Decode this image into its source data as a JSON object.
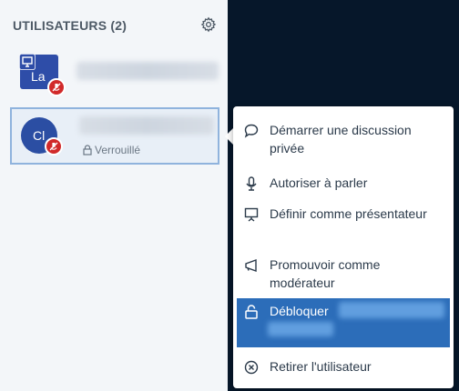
{
  "panel": {
    "title": "UTILISATEURS (2)"
  },
  "users": [
    {
      "initials": "La",
      "role": "presenter"
    },
    {
      "initials": "Cl",
      "status": "Verrouillé"
    }
  ],
  "menu": {
    "items": [
      {
        "id": "chat",
        "label": "Démarrer une discussion privée",
        "icon": "chat-bubble-icon"
      },
      {
        "id": "speak",
        "label": "Autoriser à parler",
        "icon": "microphone-icon"
      },
      {
        "id": "presenter",
        "label": "Définir comme présentateur",
        "icon": "presentation-icon"
      },
      {
        "id": "promote",
        "label": "Promouvoir comme modérateur",
        "icon": "megaphone-icon"
      },
      {
        "id": "unlock",
        "label": "Débloquer",
        "icon": "unlock-icon",
        "active": true
      },
      {
        "id": "remove",
        "label": "Retirer l'utilisateur",
        "icon": "remove-icon"
      }
    ]
  },
  "colors": {
    "accent": "#2c6db9",
    "dark": "#06172a",
    "avatar": "#2e4da8",
    "danger": "#d12a2a"
  }
}
